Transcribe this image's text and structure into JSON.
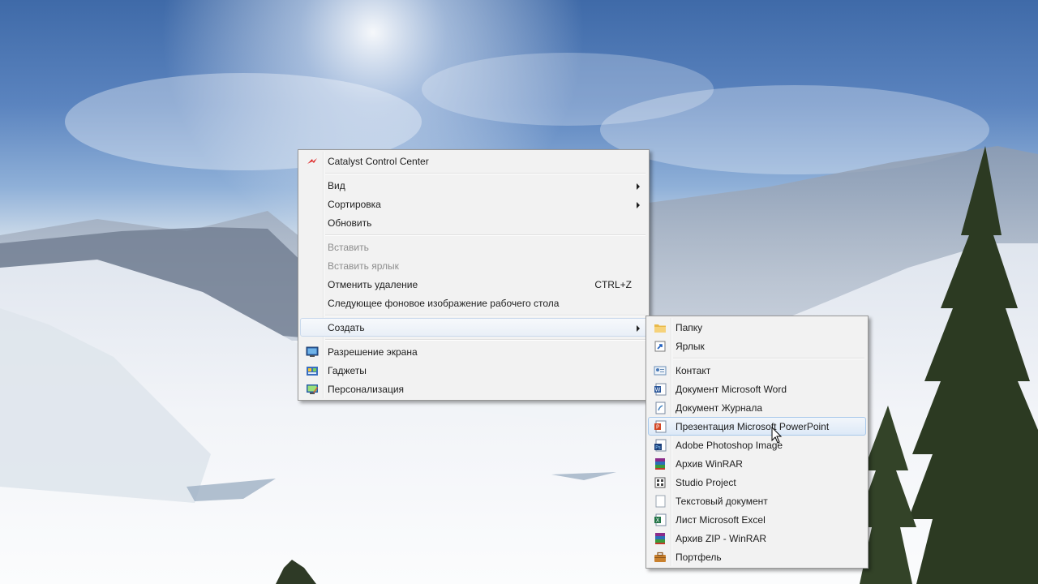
{
  "context_menu": {
    "items": [
      {
        "label": "Catalyst Control Center",
        "icon": "catalyst-icon"
      },
      {
        "label": "Вид",
        "submenu": true
      },
      {
        "label": "Сортировка",
        "submenu": true
      },
      {
        "label": "Обновить"
      },
      {
        "label": "Вставить",
        "disabled": true
      },
      {
        "label": "Вставить ярлык",
        "disabled": true
      },
      {
        "label": "Отменить удаление",
        "shortcut": "CTRL+Z"
      },
      {
        "label": "Следующее фоновое изображение рабочего стола"
      },
      {
        "label": "Создать",
        "submenu": true,
        "highlighted": true
      },
      {
        "label": "Разрешение экрана",
        "icon": "screen-resolution-icon"
      },
      {
        "label": "Гаджеты",
        "icon": "gadgets-icon"
      },
      {
        "label": "Персонализация",
        "icon": "personalization-icon"
      }
    ]
  },
  "new_submenu": {
    "items": [
      {
        "label": "Папку",
        "icon": "folder-icon"
      },
      {
        "label": "Ярлык",
        "icon": "shortcut-icon"
      },
      {
        "label": "Контакт",
        "icon": "contact-icon"
      },
      {
        "label": "Документ Microsoft Word",
        "icon": "word-document-icon"
      },
      {
        "label": "Документ Журнала",
        "icon": "journal-document-icon"
      },
      {
        "label": "Презентация Microsoft PowerPoint",
        "icon": "powerpoint-icon",
        "highlighted": true
      },
      {
        "label": "Adobe Photoshop Image",
        "icon": "photoshop-icon"
      },
      {
        "label": "Архив WinRAR",
        "icon": "winrar-icon"
      },
      {
        "label": "Studio Project",
        "icon": "studio-project-icon"
      },
      {
        "label": "Текстовый документ",
        "icon": "text-document-icon"
      },
      {
        "label": "Лист Microsoft Excel",
        "icon": "excel-icon"
      },
      {
        "label": "Архив ZIP - WinRAR",
        "icon": "winrar-zip-icon"
      },
      {
        "label": "Портфель",
        "icon": "briefcase-icon"
      }
    ]
  },
  "colors": {
    "menu_background": "#f2f2f2",
    "menu_border": "#979797",
    "highlight_border": "#a8c8ea",
    "disabled_text": "#8d8d8d"
  }
}
